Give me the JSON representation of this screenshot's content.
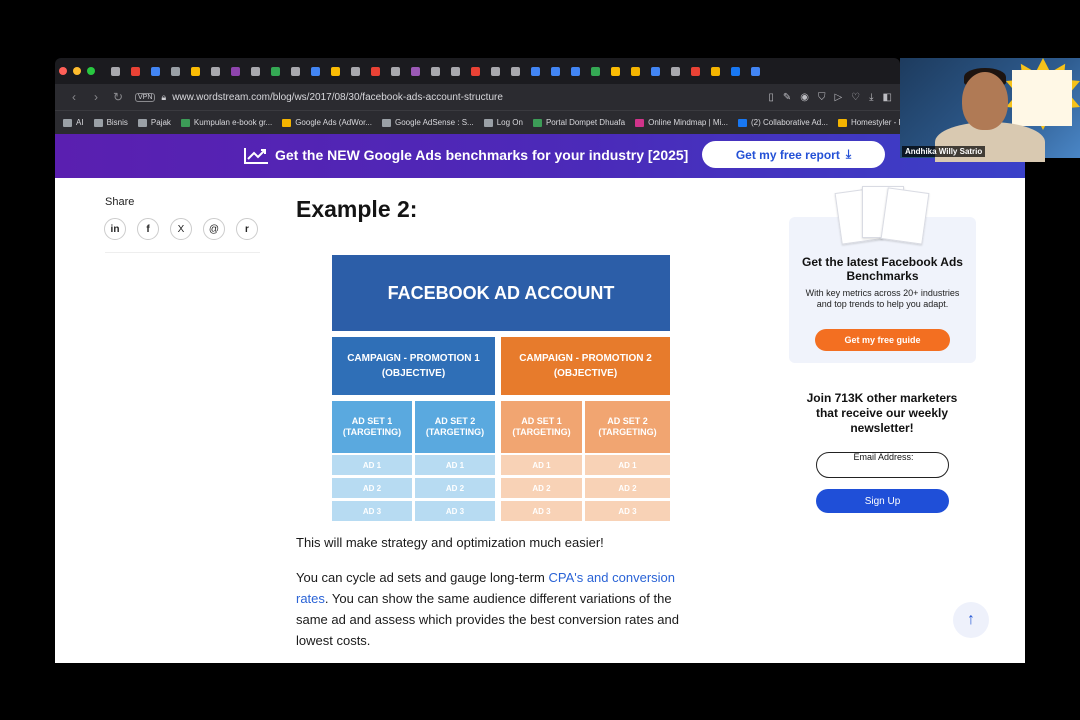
{
  "browser": {
    "url": "www.wordstream.com/blog/ws/2017/08/30/facebook-ads-account-structure",
    "vpn_label": "VPN",
    "bookmarks": [
      {
        "label": "AI",
        "color": "#9aa0a6"
      },
      {
        "label": "Bisnis",
        "color": "#9aa0a6"
      },
      {
        "label": "Pajak",
        "color": "#9aa0a6"
      },
      {
        "label": "Kumpulan e-book gr...",
        "color": "#3c9c57"
      },
      {
        "label": "Google Ads (AdWor...",
        "color": "#f4b400"
      },
      {
        "label": "Google AdSense : S...",
        "color": "#9aa0a6"
      },
      {
        "label": "Log On",
        "color": "#9aa0a6"
      },
      {
        "label": "Portal Dompet Dhuafa",
        "color": "#3c9c57"
      },
      {
        "label": "Online Mindmap | Mi...",
        "color": "#d0338a"
      },
      {
        "label": "(2) Collaborative Ad...",
        "color": "#1877f2"
      },
      {
        "label": "Homestyler - Fr...",
        "color": "#f4b400"
      }
    ]
  },
  "banner": {
    "text": "Get the NEW Google Ads benchmarks for your industry [2025]",
    "cta": "Get my free report"
  },
  "share": {
    "label": "Share",
    "icons": [
      "in",
      "f",
      "X",
      "@",
      "r"
    ]
  },
  "article": {
    "heading": "Example 2:",
    "para1": "This will make strategy and optimization much easier!",
    "para2_start": "You can cycle ad sets and gauge long-term ",
    "para2_link": "CPA's and conversion rates",
    "para2_end": ". You can show the same audience different variations of the same ad and assess which provides the best conversion rates and lowest costs."
  },
  "diagram": {
    "title": "FACEBOOK AD ACCOUNT",
    "campaign1_line1": "CAMPAIGN - PROMOTION 1",
    "campaign1_line2": "(OBJECTIVE)",
    "campaign2_line1": "CAMPAIGN - PROMOTION 2",
    "campaign2_line2": "(OBJECTIVE)",
    "adset1_line1": "AD SET 1",
    "adset2_line1": "AD SET 2",
    "adset_line2": "(TARGETING)",
    "ads": [
      "AD 1",
      "AD 2",
      "AD 3"
    ],
    "colors": {
      "header": "#2c5ea8",
      "campaign1": "#2f6fb7",
      "campaign2": "#e77b2c",
      "adset_blue": "#5aa9df",
      "adset_orange": "#f1a571",
      "ad_blue": "#b7dbf2",
      "ad_orange": "#f8d2b6"
    }
  },
  "sidebar": {
    "guide_title": "Get the latest Facebook Ads Benchmarks",
    "guide_sub": "With key metrics across 20+ industries and top trends to help you adapt.",
    "guide_btn": "Get my free guide",
    "join": "Join 713K other marketers that receive our weekly newsletter!",
    "email_label": "Email Address:",
    "signup": "Sign Up"
  },
  "webcam": {
    "name": "Andhika Willy Satrio"
  }
}
